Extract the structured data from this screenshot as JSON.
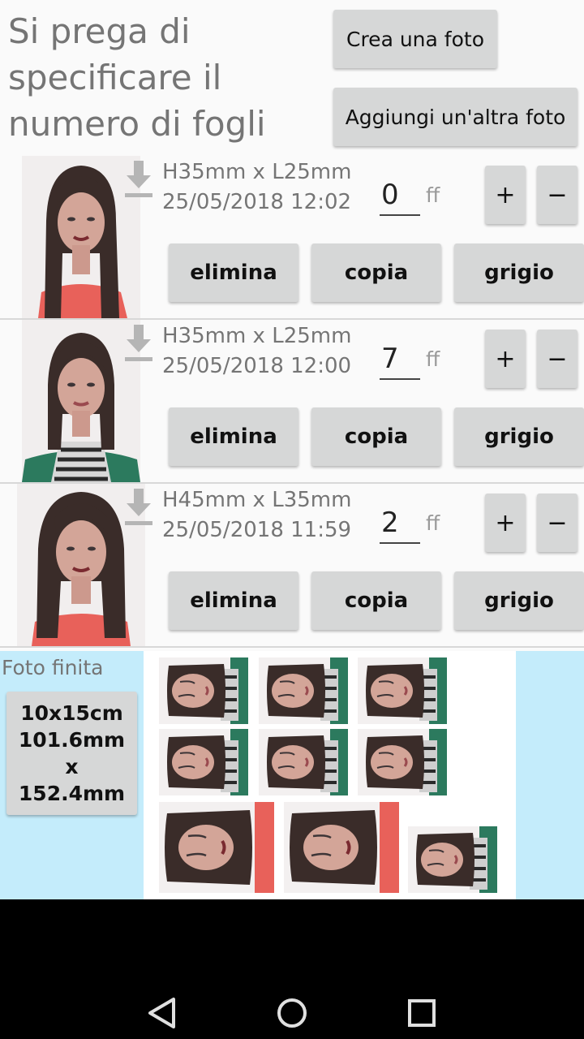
{
  "header": {
    "prompt": "Si prega di specificare il numero di fogli",
    "create_label": "Crea una foto",
    "add_label": "Aggiungi un'altra foto"
  },
  "photos": [
    {
      "size": "H35mm x L25mm",
      "date": "25/05/2018 12:02",
      "qty": "0",
      "unit": "ff",
      "plus": "+",
      "minus": "−",
      "delete": "elimina",
      "copy": "copia",
      "gray": "grigio"
    },
    {
      "size": "H35mm x L25mm",
      "date": "25/05/2018 12:00",
      "qty": "7",
      "unit": "ff",
      "plus": "+",
      "minus": "−",
      "delete": "elimina",
      "copy": "copia",
      "gray": "grigio"
    },
    {
      "size": "H45mm x L35mm",
      "date": "25/05/2018 11:59",
      "qty": "2",
      "unit": "ff",
      "plus": "+",
      "minus": "−",
      "delete": "elimina",
      "copy": "copia",
      "gray": "grigio"
    }
  ],
  "final": {
    "label": "Foto finita",
    "size_lines": [
      "10x15cm",
      "101.6mm",
      "x",
      "152.4mm"
    ]
  },
  "colors": {
    "final_bg": "#c4ecfb",
    "button_bg": "#d6d7d7",
    "hair": "#3a2c29"
  },
  "icons": [
    "download-icon",
    "back-icon",
    "home-icon",
    "recents-icon"
  ]
}
